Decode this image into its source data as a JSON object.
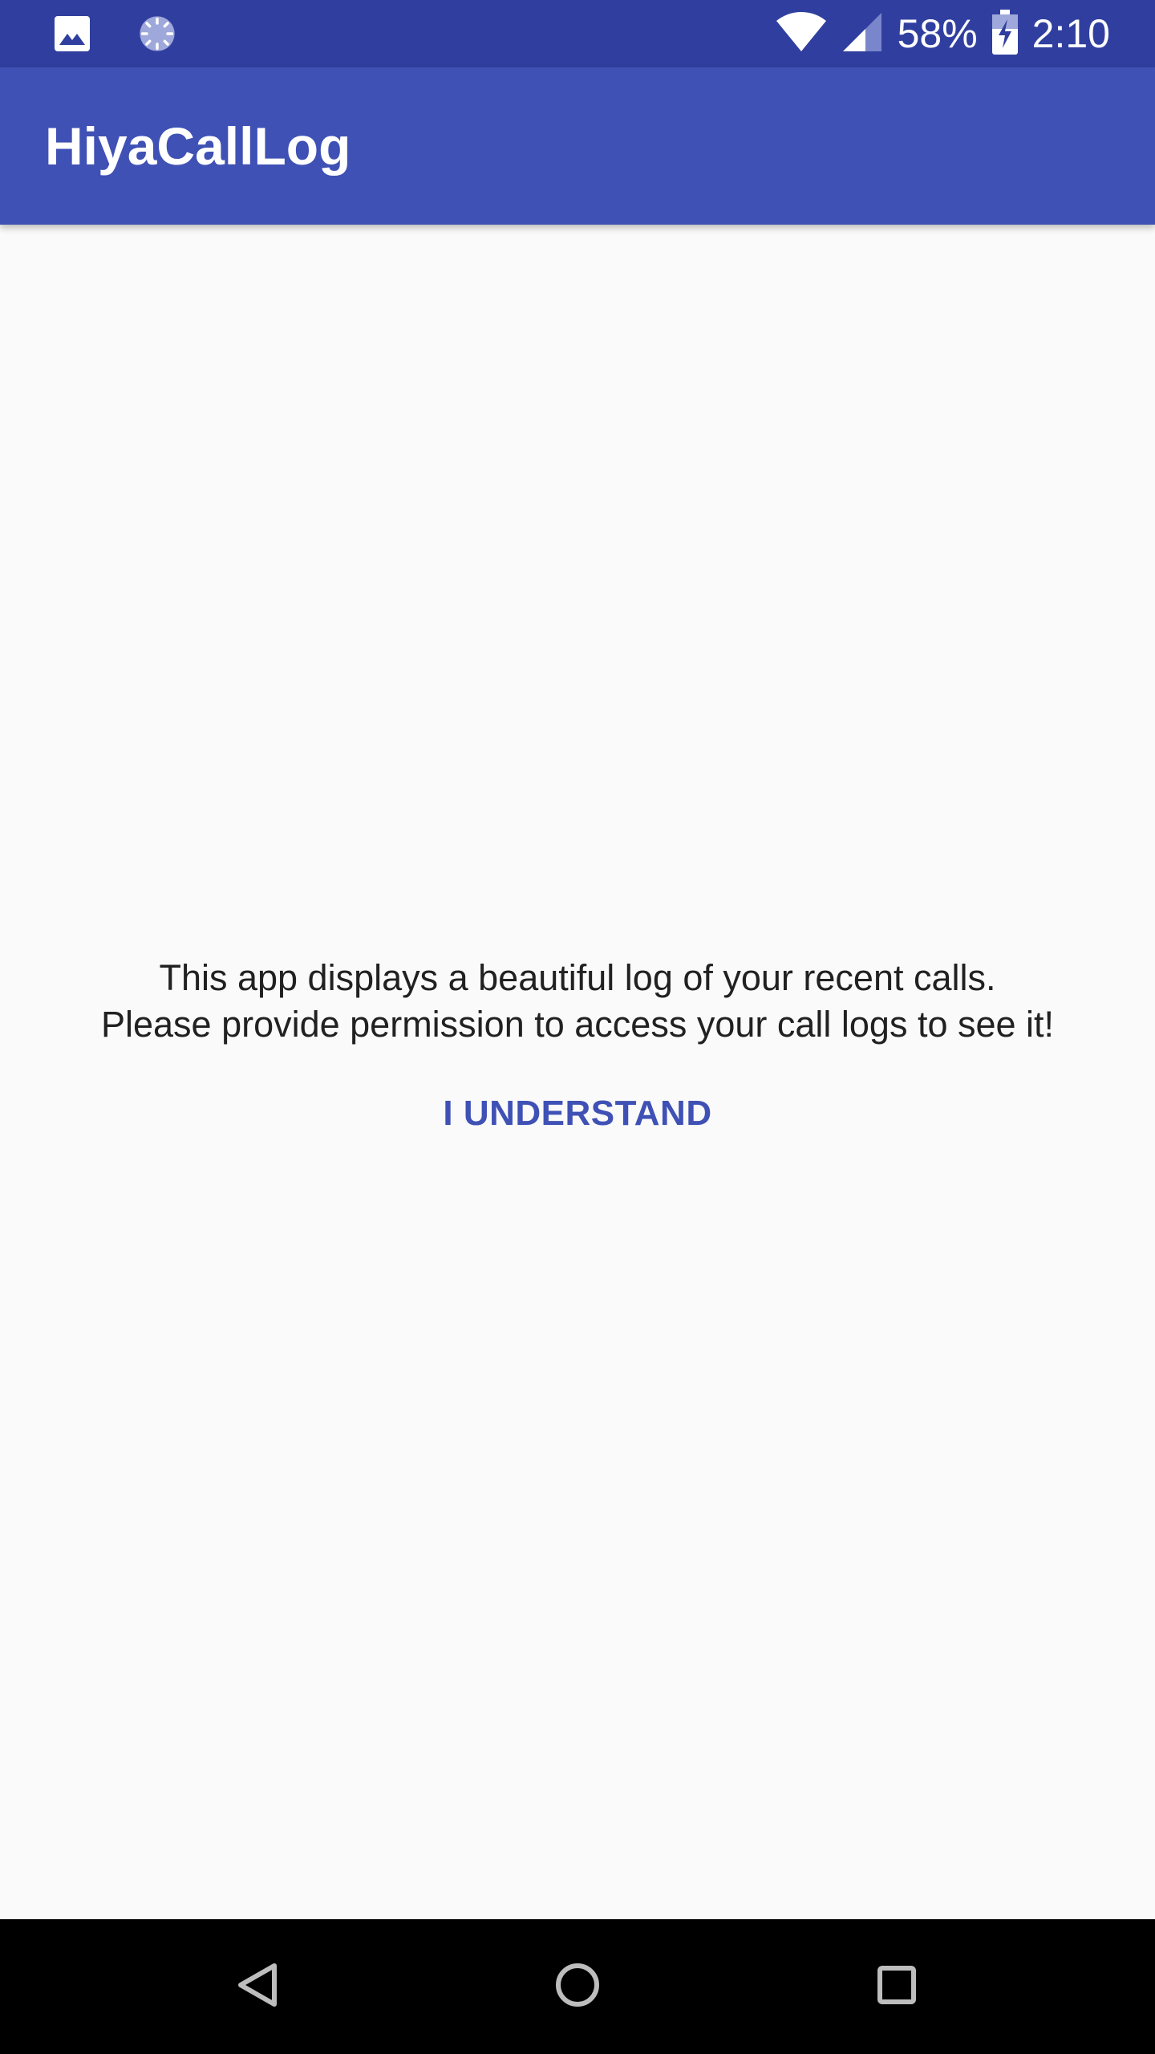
{
  "status_bar": {
    "left_icons": [
      "image-notification-icon",
      "sync-loading-icon"
    ],
    "battery_percent": "58%",
    "time": "2:10",
    "right_icons": [
      "wifi-icon",
      "cell-signal-icon",
      "battery-charging-icon"
    ]
  },
  "app_bar": {
    "title": "HiyaCallLog"
  },
  "content": {
    "message_line1": "This app displays a beautiful log of your recent calls.",
    "message_line2": "Please provide permission to access your call logs to see it!",
    "button_label": "I UNDERSTAND"
  },
  "nav_bar": {
    "buttons": [
      "back-icon",
      "home-icon",
      "recents-icon"
    ]
  },
  "colors": {
    "status_bar": "#303F9F",
    "primary": "#3F51B5",
    "background": "#FAFAFA",
    "text": "#212121",
    "nav_bar": "#000000"
  }
}
